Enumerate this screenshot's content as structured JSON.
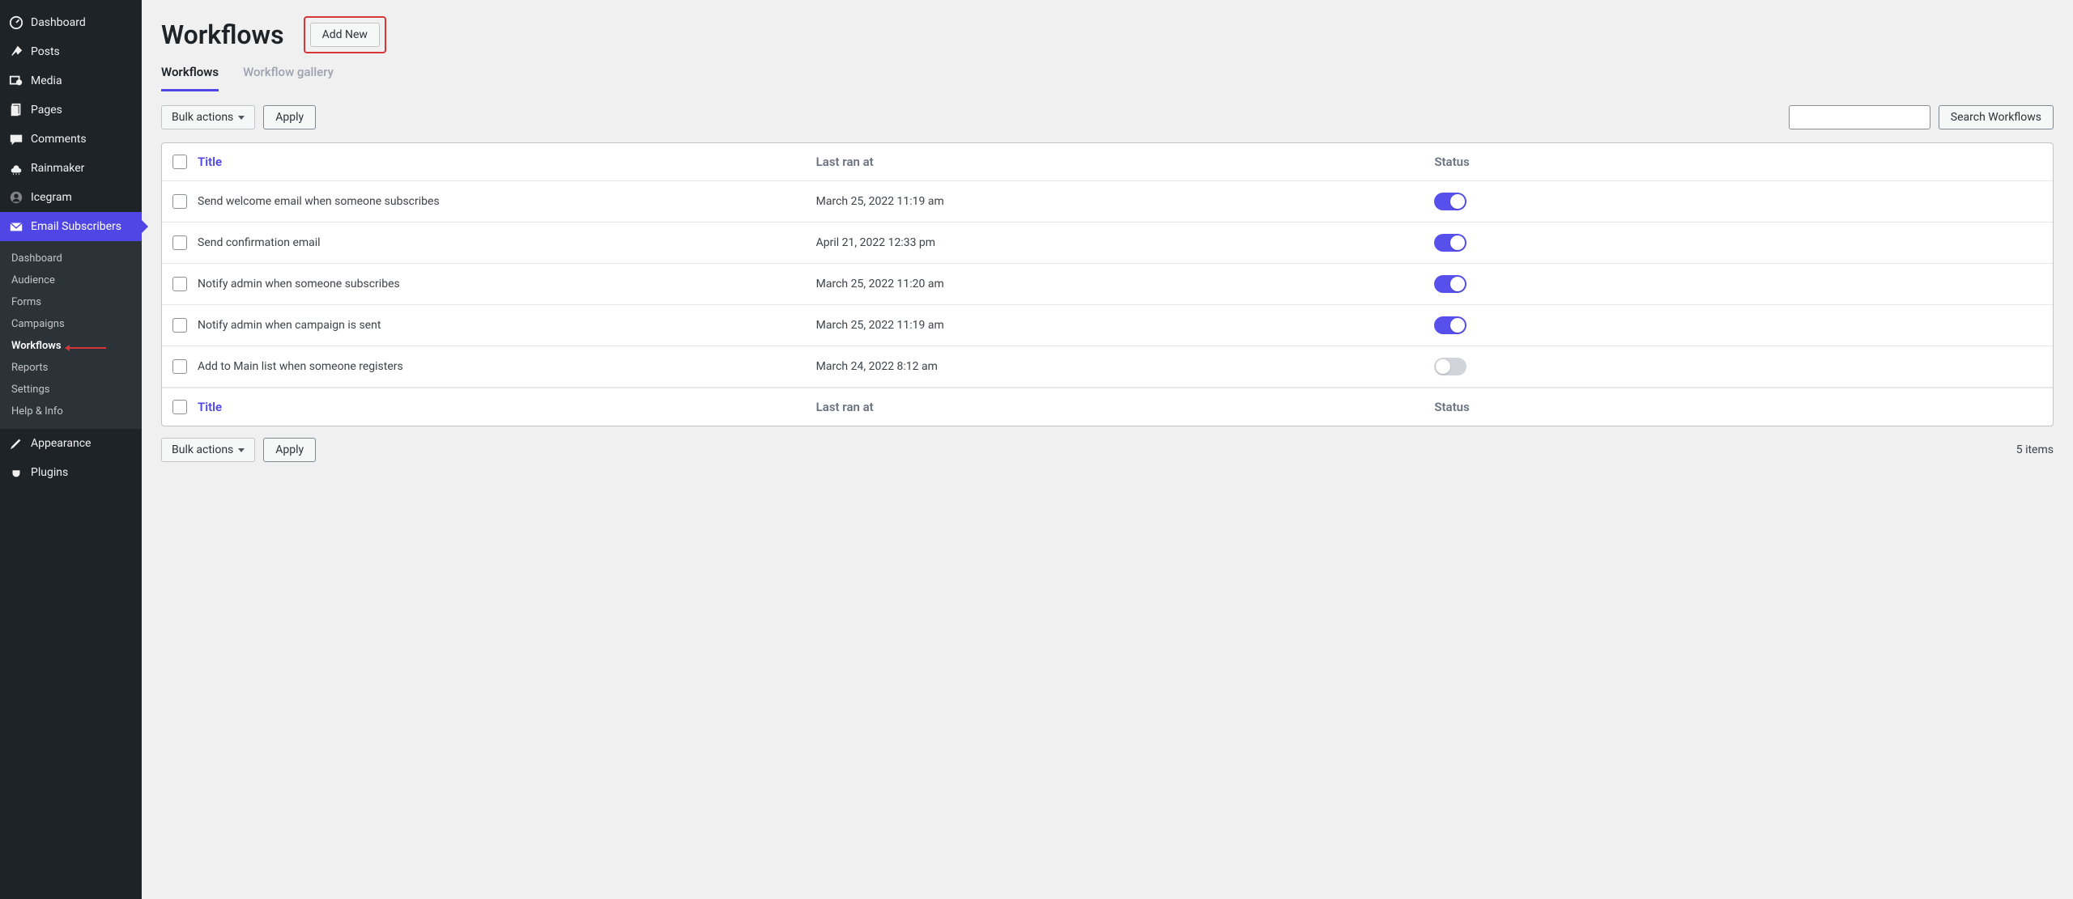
{
  "sidebar": {
    "items": [
      {
        "label": "Dashboard",
        "icon": "dashboard"
      },
      {
        "label": "Posts",
        "icon": "pin"
      },
      {
        "label": "Media",
        "icon": "media"
      },
      {
        "label": "Pages",
        "icon": "page"
      },
      {
        "label": "Comments",
        "icon": "comment"
      },
      {
        "label": "Rainmaker",
        "icon": "cloud"
      },
      {
        "label": "Icegram",
        "icon": "user"
      },
      {
        "label": "Email Subscribers",
        "icon": "email",
        "active": true
      },
      {
        "label": "Appearance",
        "icon": "brush"
      },
      {
        "label": "Plugins",
        "icon": "plug"
      }
    ],
    "submenu": [
      {
        "label": "Dashboard"
      },
      {
        "label": "Audience"
      },
      {
        "label": "Forms"
      },
      {
        "label": "Campaigns"
      },
      {
        "label": "Workflows",
        "current": true
      },
      {
        "label": "Reports"
      },
      {
        "label": "Settings"
      },
      {
        "label": "Help & Info"
      }
    ]
  },
  "header": {
    "title": "Workflows",
    "add_new": "Add New"
  },
  "tabs": [
    {
      "label": "Workflows",
      "active": true
    },
    {
      "label": "Workflow gallery"
    }
  ],
  "toolbar": {
    "bulk_label": "Bulk actions",
    "apply_label": "Apply",
    "search_label": "Search Workflows"
  },
  "table": {
    "headers": {
      "title": "Title",
      "last_ran": "Last ran at",
      "status": "Status"
    },
    "rows": [
      {
        "title": "Send welcome email when someone subscribes",
        "date": "March 25, 2022 11:19 am",
        "status": true
      },
      {
        "title": "Send confirmation email",
        "date": "April 21, 2022 12:33 pm",
        "status": true
      },
      {
        "title": "Notify admin when someone subscribes",
        "date": "March 25, 2022 11:20 am",
        "status": true
      },
      {
        "title": "Notify admin when campaign is sent",
        "date": "March 25, 2022 11:19 am",
        "status": true
      },
      {
        "title": "Add to Main list when someone registers",
        "date": "March 24, 2022 8:12 am",
        "status": false
      }
    ]
  },
  "footer": {
    "items_count": "5 items"
  }
}
